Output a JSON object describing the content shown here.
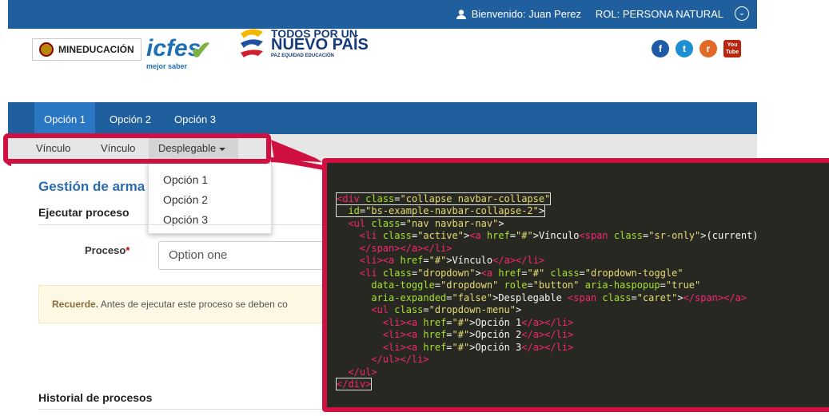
{
  "topbar": {
    "welcome": "Bienvenido: Juan Perez",
    "role": "ROL: PERSONA NATURAL"
  },
  "logos": {
    "mineducacion": "MINEDUCACIÓN",
    "icfes": "icfes",
    "icfes_sub": "mejor saber",
    "pais_line1": "TODOS POR UN",
    "pais_line2": "NUEVO PAÍS",
    "pais_line3": "PAZ EQUIDAD EDUCACIÓN"
  },
  "social": [
    {
      "name": "facebook",
      "glyph": "f",
      "color": "#1e5aa8"
    },
    {
      "name": "twitter",
      "glyph": "t",
      "color": "#1e8fd1"
    },
    {
      "name": "rss",
      "glyph": "r",
      "color": "#e06a26"
    },
    {
      "name": "youtube",
      "glyph": "You Tube",
      "color": "#b8260f"
    }
  ],
  "nav": {
    "items": [
      "Opción 1",
      "Opción 2",
      "Opción 3"
    ]
  },
  "subnav": {
    "items": [
      "Vínculo",
      "Vínculo",
      "Desplegable"
    ]
  },
  "dropdown": {
    "options": [
      "Opción 1",
      "Opción 2",
      "Opción 3"
    ]
  },
  "content": {
    "title": "Gestión de arma",
    "section1": "Ejecutar proceso",
    "process_label": "Proceso",
    "process_required": "*",
    "process_value": "Option one",
    "alert_bold": "Recuerde.",
    "alert_text": " Antes de ejecutar este proceso se deben co",
    "section2": "Historial de procesos"
  },
  "code_lines": [
    "<div class=\"collapse navbar-collapse\"",
    "  id=\"bs-example-navbar-collapse-2\">",
    "  <ul class=\"nav navbar-nav\">",
    "    <li class=\"active\"><a href=\"#\">Vínculo<span class=\"sr-only\">(current)",
    "    </span></a></li>",
    "    <li><a href=\"#\">Vínculo</a></li>",
    "    <li class=\"dropdown\"><a href=\"#\" class=\"dropdown-toggle\"",
    "      data-toggle=\"dropdown\" role=\"button\" aria-haspopup=\"true\"",
    "      aria-expanded=\"false\">Desplegable <span class=\"caret\"></span></a>",
    "      <ul class=\"dropdown-menu\">",
    "        <li><a href=\"#\">Opción 1</a></li>",
    "        <li><a href=\"#\">Opción 2</a></li>",
    "        <li><a href=\"#\">Opción 3</a></li>",
    "      </ul></li>",
    "  </ul>",
    "</div>"
  ]
}
